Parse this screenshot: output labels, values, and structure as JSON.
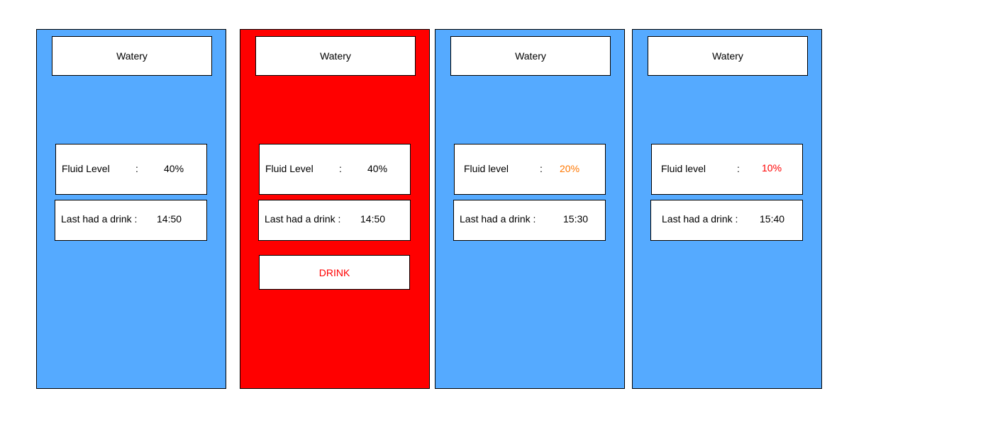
{
  "colors": {
    "screen_default": "#55aaff",
    "screen_alert": "#ff0000",
    "level_ok": "#000000",
    "level_warning": "#ff7700",
    "level_critical": "#ff0000",
    "drink_label": "#ff0000"
  },
  "screens": [
    {
      "title": "Watery",
      "fluid_label": "Fluid Level",
      "colon": ":",
      "fluid_value": "40%",
      "fluid_value_color": "#000000",
      "last_drink_label": "Last had a drink :",
      "last_drink_time": "14:50",
      "background": "#55aaff"
    },
    {
      "title": "Watery",
      "fluid_label": "Fluid Level",
      "colon": ":",
      "fluid_value": "40%",
      "fluid_value_color": "#000000",
      "last_drink_label": "Last had a drink :",
      "last_drink_time": "14:50",
      "drink_button_label": "DRINK",
      "background": "#ff0000"
    },
    {
      "title": "Watery",
      "fluid_label": "Fluid level",
      "colon": ":",
      "fluid_value": "20%",
      "fluid_value_color": "#ff7700",
      "last_drink_label": "Last had a drink :",
      "last_drink_time": "15:30",
      "background": "#55aaff"
    },
    {
      "title": "Watery",
      "fluid_label": "Fluid level",
      "colon": ":",
      "fluid_value": "10%",
      "fluid_value_color": "#ff0000",
      "last_drink_label": "Last had a drink :",
      "last_drink_time": "15:40",
      "background": "#55aaff"
    }
  ]
}
